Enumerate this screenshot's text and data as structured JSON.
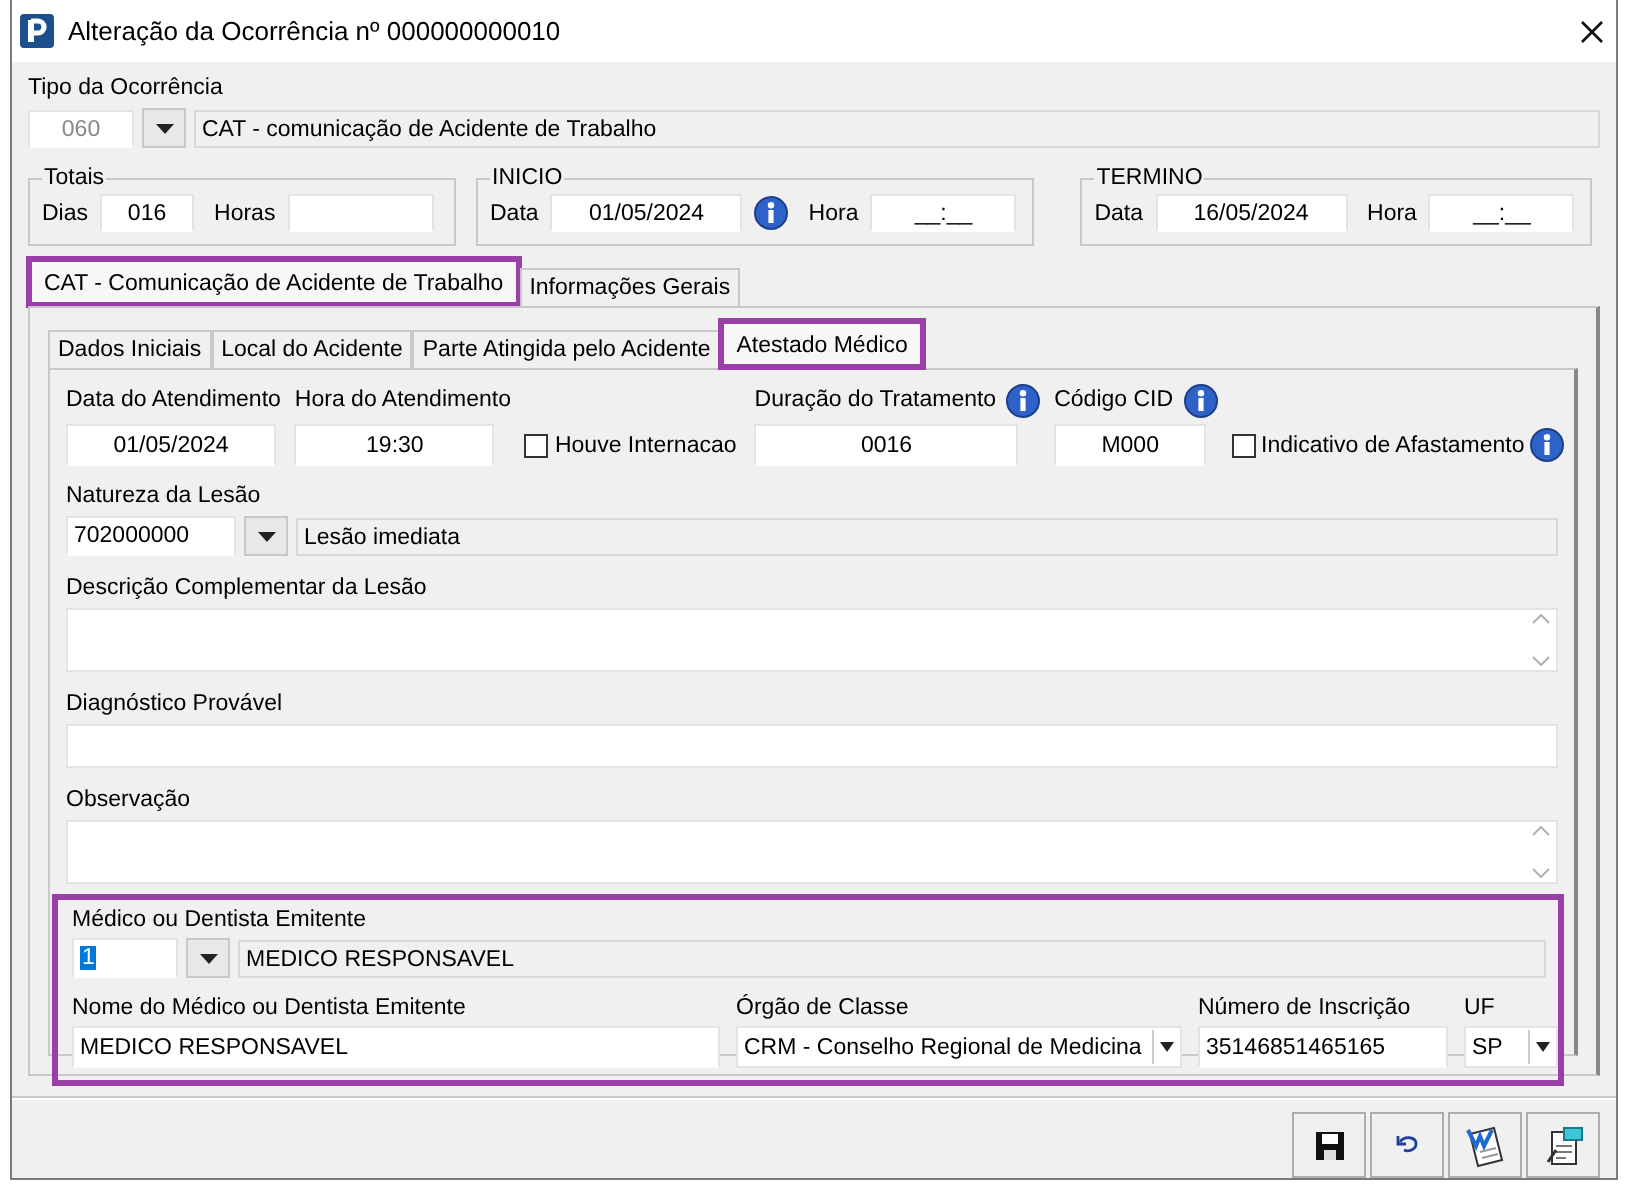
{
  "window": {
    "title": "Alteração da Ocorrência nº 000000000010"
  },
  "tipo": {
    "label": "Tipo da Ocorrência",
    "code": "060",
    "code_disabled": true,
    "description": "CAT - comunicação de Acidente de Trabalho"
  },
  "groups": [
    {
      "legend": "Totais",
      "fields": [
        {
          "label": "Dias",
          "value": "016"
        },
        {
          "label": "Horas"
        }
      ]
    },
    {
      "legend": "INICIO",
      "fields": [
        {
          "label": "Data",
          "value": "01/05/2024",
          "info": true
        },
        {
          "label": "Hora",
          "value": "__:__"
        }
      ]
    },
    {
      "legend": "TERMINO",
      "fields": [
        {
          "label": "Data",
          "value": "16/05/2024"
        },
        {
          "label": "Hora",
          "value": "__:__"
        }
      ]
    }
  ],
  "main_tabs": [
    {
      "label": "CAT - Comunicação de Acidente de Trabalho",
      "selected": true,
      "highlighted": true
    },
    {
      "label": "Informações Gerais",
      "selected": false,
      "highlighted": false
    }
  ],
  "sub_tabs": [
    {
      "label": "Dados Iniciais",
      "selected": false,
      "highlighted": false
    },
    {
      "label": "Local do Acidente",
      "selected": false,
      "highlighted": false
    },
    {
      "label": "Parte Atingida pelo Acidente",
      "selected": false,
      "highlighted": false
    },
    {
      "label": "Atestado Médico",
      "selected": true,
      "highlighted": true
    }
  ],
  "atendimento": [
    {
      "kind": "text",
      "label": "Data do Atendimento",
      "value": "01/05/2024"
    },
    {
      "kind": "text",
      "label": "Hora do Atendimento",
      "value": "19:30"
    },
    {
      "kind": "checkbox",
      "label": "Houve Internacao",
      "checked": false
    },
    {
      "kind": "text",
      "label": "Duração do Tratamento",
      "value": "0016",
      "info": true
    },
    {
      "kind": "text",
      "label": "Código CID",
      "value": "M000",
      "info": true
    },
    {
      "kind": "checkbox",
      "label": "Indicativo de Afastamento",
      "checked": false,
      "info": true
    }
  ],
  "natureza": {
    "label": "Natureza da Lesão",
    "code": "702000000",
    "description": "Lesão imediata"
  },
  "notes": [
    {
      "kind": "memo",
      "label": "Descrição Complementar da Lesão"
    },
    {
      "kind": "line",
      "label": "Diagnóstico Provável"
    },
    {
      "kind": "memo",
      "label": "Observação"
    }
  ],
  "emitente": {
    "highlighted": true,
    "label": "Médico ou Dentista Emitente",
    "code": "1",
    "code_text_selected": true,
    "description": "MEDICO RESPONSAVEL",
    "fields": [
      {
        "kind": "text",
        "label": "Nome do Médico ou Dentista Emitente",
        "value": "MEDICO RESPONSAVEL"
      },
      {
        "kind": "select",
        "label": "Órgão de Classe",
        "value": "CRM - Conselho Regional de Medicina"
      },
      {
        "kind": "text",
        "label": "Número de Inscrição",
        "value": "35146851465165"
      },
      {
        "kind": "select",
        "label": "UF",
        "value": "SP"
      }
    ]
  }
}
